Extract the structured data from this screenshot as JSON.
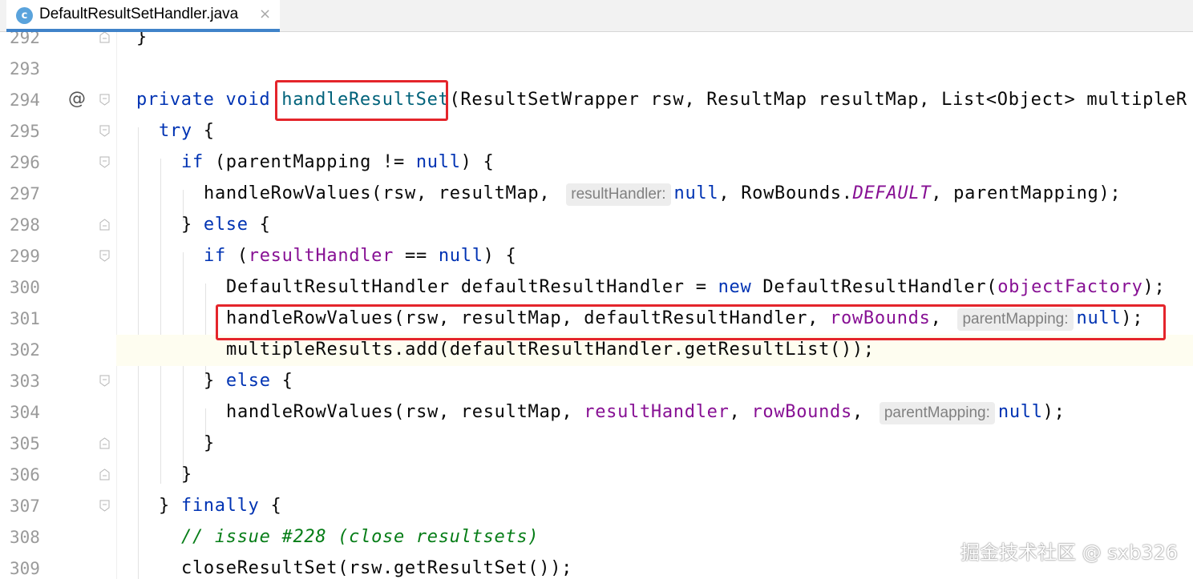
{
  "tab": {
    "icon_letter": "c",
    "title": "DefaultResultSetHandler.java",
    "close_glyph": "×"
  },
  "lines": [
    {
      "number": "292"
    },
    {
      "number": "293"
    },
    {
      "number": "294",
      "gutter_icon": "@"
    },
    {
      "number": "295"
    },
    {
      "number": "296"
    },
    {
      "number": "297"
    },
    {
      "number": "298"
    },
    {
      "number": "299"
    },
    {
      "number": "300"
    },
    {
      "number": "301"
    },
    {
      "number": "302"
    },
    {
      "number": "303"
    },
    {
      "number": "304"
    },
    {
      "number": "305"
    },
    {
      "number": "306"
    },
    {
      "number": "307"
    },
    {
      "number": "308"
    },
    {
      "number": "309"
    }
  ],
  "code": {
    "l292": {
      "text": "}"
    },
    "l294": {
      "kw": "private void ",
      "method": "handleResultSet",
      "rest": "(ResultSetWrapper rsw, ResultMap resultMap, List<Object> multipleR"
    },
    "l295": {
      "kw": "try",
      "rest": " {"
    },
    "l296": {
      "kw": "if",
      "mid": " (parentMapping != ",
      "kw2": "null",
      "rest": ") {"
    },
    "l297": {
      "a": "handleRowValues(rsw, resultMap, ",
      "hint": "resultHandler:",
      "kw": "null",
      "b": ", RowBounds.",
      "const": "DEFAULT",
      "c": ", parentMapping);"
    },
    "l298": {
      "a": "} ",
      "kw": "else",
      "b": " {"
    },
    "l299": {
      "kw": "if",
      "a": " (",
      "field": "resultHandler",
      "b": " == ",
      "kw2": "null",
      "c": ") {"
    },
    "l300": {
      "a": "DefaultResultHandler defaultResultHandler = ",
      "kw": "new",
      "b": " DefaultResultHandler(",
      "field": "objectFactory",
      "c": ");"
    },
    "l301": {
      "a": "handleRowValues(rsw, resultMap, defaultResultHandler, ",
      "field": "rowBounds",
      "b": ", ",
      "hint": "parentMapping:",
      "kw": "null",
      "c": ");"
    },
    "l302": {
      "text": "multipleResults.add(defaultResultHandler.getResultList());"
    },
    "l303": {
      "a": "} ",
      "kw": "else",
      "b": " {"
    },
    "l304": {
      "a": "handleRowValues(rsw, resultMap, ",
      "field1": "resultHandler",
      "b": ", ",
      "field2": "rowBounds",
      "c": ", ",
      "hint": "parentMapping:",
      "kw": "null",
      "d": ");"
    },
    "l305": {
      "text": "}"
    },
    "l306": {
      "text": "}"
    },
    "l307": {
      "a": "} ",
      "kw": "finally",
      "b": " {"
    },
    "l308": {
      "comment": "// issue #228 (close resultsets)"
    },
    "l309": {
      "text": "closeResultSet(rsw.getResultSet());"
    }
  },
  "colors": {
    "keyword": "#0033b3",
    "method_decl": "#00627a",
    "field": "#871094",
    "comment": "#067d17",
    "highlight_box": "#e4252b",
    "tab_underline": "#4083c9"
  },
  "watermark": "掘金技术社区 @ sxb326"
}
